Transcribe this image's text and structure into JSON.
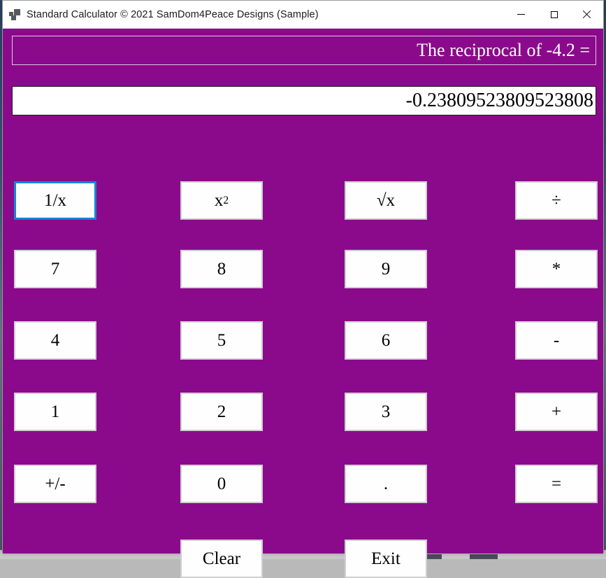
{
  "window": {
    "title": "Standard Calculator © 2021 SamDom4Peace Designs (Sample)",
    "app_icon": "vs-app-icon",
    "accent_color": "#8b0a8b",
    "controls": {
      "minimize": "minimize-icon",
      "maximize": "maximize-icon",
      "close": "close-icon"
    }
  },
  "display": {
    "expression_label": "The reciprocal of -4.2 =",
    "result_value": "-0.23809523809523808"
  },
  "keypad": {
    "rows": [
      [
        {
          "label": "1/x",
          "name": "reciprocal-button",
          "focused": true
        },
        {
          "label": "x²",
          "name": "square-button",
          "focused": false
        },
        {
          "label": "√x",
          "name": "sqrt-button",
          "focused": false
        },
        {
          "label": "÷",
          "name": "divide-button",
          "focused": false
        }
      ],
      [
        {
          "label": "7",
          "name": "digit-7-button",
          "focused": false
        },
        {
          "label": "8",
          "name": "digit-8-button",
          "focused": false
        },
        {
          "label": "9",
          "name": "digit-9-button",
          "focused": false
        },
        {
          "label": "*",
          "name": "multiply-button",
          "focused": false
        }
      ],
      [
        {
          "label": "4",
          "name": "digit-4-button",
          "focused": false
        },
        {
          "label": "5",
          "name": "digit-5-button",
          "focused": false
        },
        {
          "label": "6",
          "name": "digit-6-button",
          "focused": false
        },
        {
          "label": "-",
          "name": "subtract-button",
          "focused": false
        }
      ],
      [
        {
          "label": "1",
          "name": "digit-1-button",
          "focused": false
        },
        {
          "label": "2",
          "name": "digit-2-button",
          "focused": false
        },
        {
          "label": "3",
          "name": "digit-3-button",
          "focused": false
        },
        {
          "label": "+",
          "name": "add-button",
          "focused": false
        }
      ],
      [
        {
          "label": "+/-",
          "name": "sign-toggle-button",
          "focused": false
        },
        {
          "label": "0",
          "name": "digit-0-button",
          "focused": false
        },
        {
          "label": ".",
          "name": "decimal-point-button",
          "focused": false
        },
        {
          "label": "=",
          "name": "equals-button",
          "focused": false
        }
      ]
    ],
    "bottom": [
      {
        "label": "Clear",
        "name": "clear-button",
        "focused": false
      },
      {
        "label": "Exit",
        "name": "exit-button",
        "focused": false
      }
    ]
  }
}
